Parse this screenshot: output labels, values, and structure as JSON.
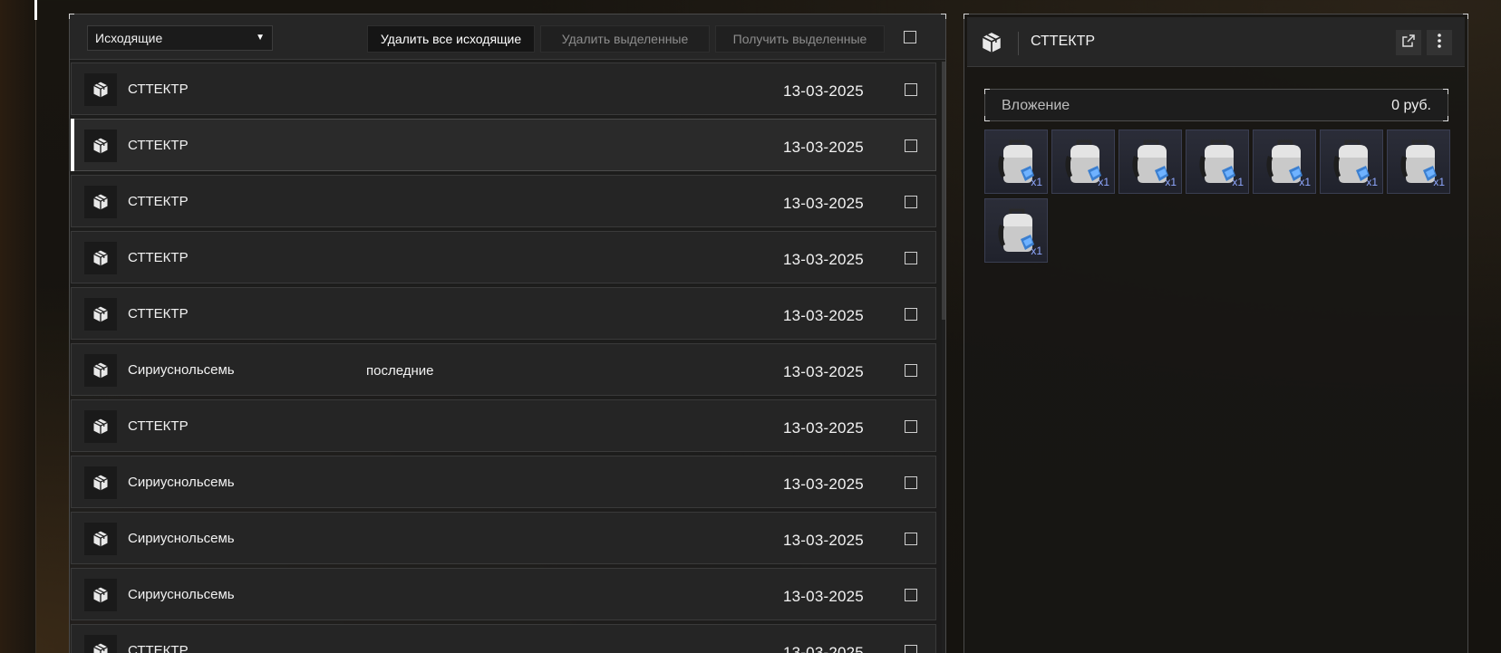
{
  "toolbar": {
    "folder_select": "Исходящие",
    "delete_all_label": "Удалить все исходящие",
    "delete_selected_label": "Удалить выделенные",
    "receive_selected_label": "Получить выделенные"
  },
  "messages": [
    {
      "sender": "СТТЕКТР",
      "subject": "",
      "date": "13-03-2025",
      "selected": false
    },
    {
      "sender": "СТТЕКТР",
      "subject": "",
      "date": "13-03-2025",
      "selected": true
    },
    {
      "sender": "СТТЕКТР",
      "subject": "",
      "date": "13-03-2025",
      "selected": false
    },
    {
      "sender": "СТТЕКТР",
      "subject": "",
      "date": "13-03-2025",
      "selected": false
    },
    {
      "sender": "СТТЕКТР",
      "subject": "",
      "date": "13-03-2025",
      "selected": false
    },
    {
      "sender": "Сириуснольсемь",
      "subject": "последние",
      "date": "13-03-2025",
      "selected": false
    },
    {
      "sender": "СТТЕКТР",
      "subject": "",
      "date": "13-03-2025",
      "selected": false
    },
    {
      "sender": "Сириуснольсемь",
      "subject": "",
      "date": "13-03-2025",
      "selected": false
    },
    {
      "sender": "Сириуснольсемь",
      "subject": "",
      "date": "13-03-2025",
      "selected": false
    },
    {
      "sender": "Сириуснольсемь",
      "subject": "",
      "date": "13-03-2025",
      "selected": false
    },
    {
      "sender": "СТТЕКТР",
      "subject": "",
      "date": "13-03-2025",
      "selected": false
    }
  ],
  "detail": {
    "title": "СТТЕКТР",
    "attachment_label": "Вложение",
    "attachment_price": "0 руб.",
    "items": [
      {
        "qty": "x1",
        "icon": "backpack-icon"
      },
      {
        "qty": "x1",
        "icon": "backpack-icon"
      },
      {
        "qty": "x1",
        "icon": "backpack-icon"
      },
      {
        "qty": "x1",
        "icon": "backpack-icon"
      },
      {
        "qty": "x1",
        "icon": "backpack-icon"
      },
      {
        "qty": "x1",
        "icon": "backpack-icon"
      },
      {
        "qty": "x1",
        "icon": "backpack-icon"
      },
      {
        "qty": "x1",
        "icon": "backpack-icon"
      }
    ]
  },
  "icons": {
    "message_row": "package-icon",
    "header": "package-icon",
    "open_external": "external-link-icon",
    "more": "kebab-menu-icon"
  },
  "colors": {
    "accent": "#ffffff",
    "item_qty": "#8fa8ff",
    "panel_bg": "#252525"
  }
}
